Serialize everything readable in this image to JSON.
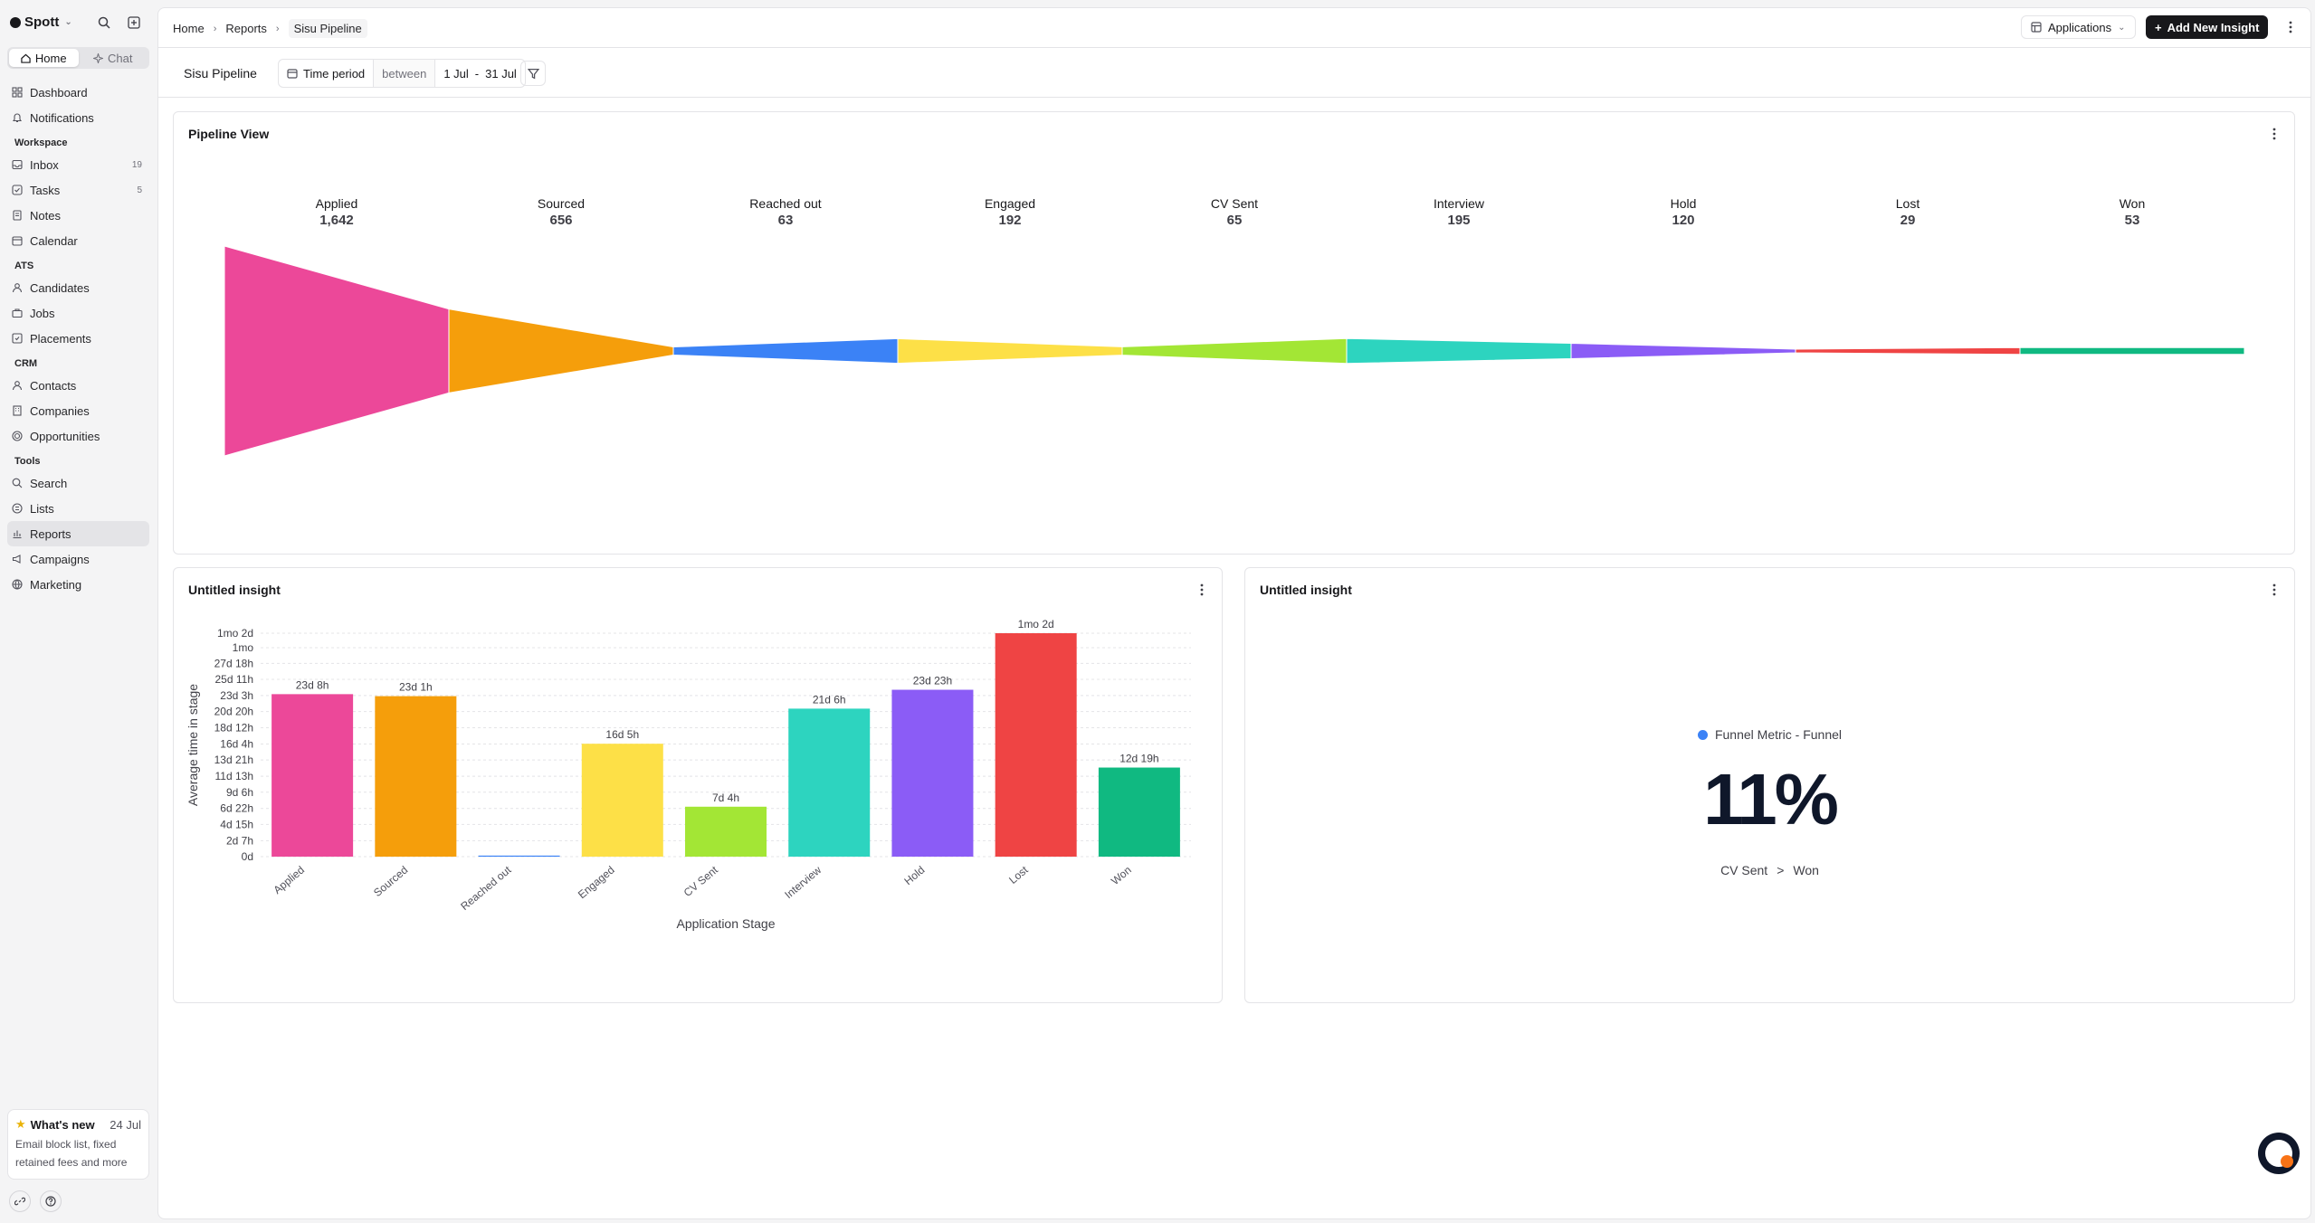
{
  "app": {
    "brand": "Spott",
    "mode_tabs": [
      {
        "label": "Home",
        "icon": "home-icon"
      },
      {
        "label": "Chat",
        "icon": "sparkle-icon"
      }
    ]
  },
  "sidebar": {
    "top": [
      {
        "label": "Dashboard",
        "icon": "dashboard-icon"
      },
      {
        "label": "Notifications",
        "icon": "bell-icon"
      }
    ],
    "sections": [
      {
        "title": "Workspace",
        "items": [
          {
            "label": "Inbox",
            "icon": "inbox-icon",
            "count": "19"
          },
          {
            "label": "Tasks",
            "icon": "checkbox-icon",
            "count": "5"
          },
          {
            "label": "Notes",
            "icon": "note-icon"
          },
          {
            "label": "Calendar",
            "icon": "calendar-icon"
          }
        ]
      },
      {
        "title": "ATS",
        "items": [
          {
            "label": "Candidates",
            "icon": "user-icon"
          },
          {
            "label": "Jobs",
            "icon": "briefcase-icon"
          },
          {
            "label": "Placements",
            "icon": "placement-icon"
          }
        ]
      },
      {
        "title": "CRM",
        "items": [
          {
            "label": "Contacts",
            "icon": "contact-icon"
          },
          {
            "label": "Companies",
            "icon": "building-icon"
          },
          {
            "label": "Opportunities",
            "icon": "target-icon"
          }
        ]
      },
      {
        "title": "Tools",
        "items": [
          {
            "label": "Search",
            "icon": "search-icon"
          },
          {
            "label": "Lists",
            "icon": "list-icon"
          },
          {
            "label": "Reports",
            "icon": "chart-icon",
            "active": true
          },
          {
            "label": "Campaigns",
            "icon": "megaphone-icon"
          },
          {
            "label": "Marketing",
            "icon": "globe-icon"
          }
        ]
      }
    ],
    "whats_new": {
      "title": "What's new",
      "date": "24 Jul",
      "body": "Email block list, fixed retained fees and more"
    }
  },
  "header": {
    "breadcrumbs": [
      "Home",
      "Reports",
      "Sisu Pipeline"
    ],
    "applications_label": "Applications",
    "add_button_label": "Add New Insight"
  },
  "filters": {
    "page_title": "Sisu Pipeline",
    "time_period_label": "Time period",
    "operator": "between",
    "start": "1 Jul",
    "range_sep": "-",
    "end": "31 Jul"
  },
  "colors": {
    "accent": "#18181b",
    "stages": [
      "#ec4899",
      "#f59e0b",
      "#3b82f6",
      "#fde047",
      "#a3e635",
      "#2dd4bf",
      "#8b5cf6",
      "#ef4444",
      "#10b981"
    ]
  },
  "pipeline_card": {
    "title": "Pipeline View",
    "chart_data": {
      "type": "funnel",
      "stages": [
        "Applied",
        "Sourced",
        "Reached out",
        "Engaged",
        "CV Sent",
        "Interview",
        "Hold",
        "Lost",
        "Won"
      ],
      "values": [
        1642,
        656,
        63,
        192,
        65,
        195,
        120,
        29,
        53
      ],
      "value_labels": [
        "1,642",
        "656",
        "63",
        "192",
        "65",
        "195",
        "120",
        "29",
        "53"
      ]
    }
  },
  "bar_card": {
    "title": "Untitled insight",
    "chart_data": {
      "type": "bar",
      "categories": [
        "Applied",
        "Sourced",
        "Reached out",
        "Engaged",
        "CV Sent",
        "Interview",
        "Hold",
        "Lost",
        "Won"
      ],
      "values": [
        23.33,
        23.04,
        0.15,
        16.21,
        7.17,
        21.25,
        23.96,
        32.08,
        12.79
      ],
      "data_labels": [
        "23d 8h",
        "23d 1h",
        "",
        "16d 5h",
        "7d 4h",
        "21d 6h",
        "23d 23h",
        "1mo 2d",
        "12d 19h"
      ],
      "y_ticks": [
        {
          "v": 0,
          "label": "0d"
        },
        {
          "v": 2.29,
          "label": "2d 7h"
        },
        {
          "v": 4.63,
          "label": "4d 15h"
        },
        {
          "v": 6.92,
          "label": "6d 22h"
        },
        {
          "v": 9.25,
          "label": "9d 6h"
        },
        {
          "v": 11.54,
          "label": "11d 13h"
        },
        {
          "v": 13.88,
          "label": "13d 21h"
        },
        {
          "v": 16.17,
          "label": "16d 4h"
        },
        {
          "v": 18.5,
          "label": "18d 12h"
        },
        {
          "v": 20.83,
          "label": "20d 20h"
        },
        {
          "v": 23.13,
          "label": "23d 3h"
        },
        {
          "v": 25.46,
          "label": "25d 11h"
        },
        {
          "v": 27.75,
          "label": "27d 18h"
        },
        {
          "v": 30,
          "label": "1mo"
        },
        {
          "v": 32.08,
          "label": "1mo 2d"
        }
      ],
      "xlabel": "Application Stage",
      "ylabel": "Average time in stage",
      "ylim": [
        0,
        32.08
      ],
      "grid": true
    }
  },
  "metric_card": {
    "title": "Untitled insight",
    "legend": "Funnel Metric - Funnel",
    "value": "11%",
    "from": "CV Sent",
    "arrow": ">",
    "to": "Won"
  }
}
